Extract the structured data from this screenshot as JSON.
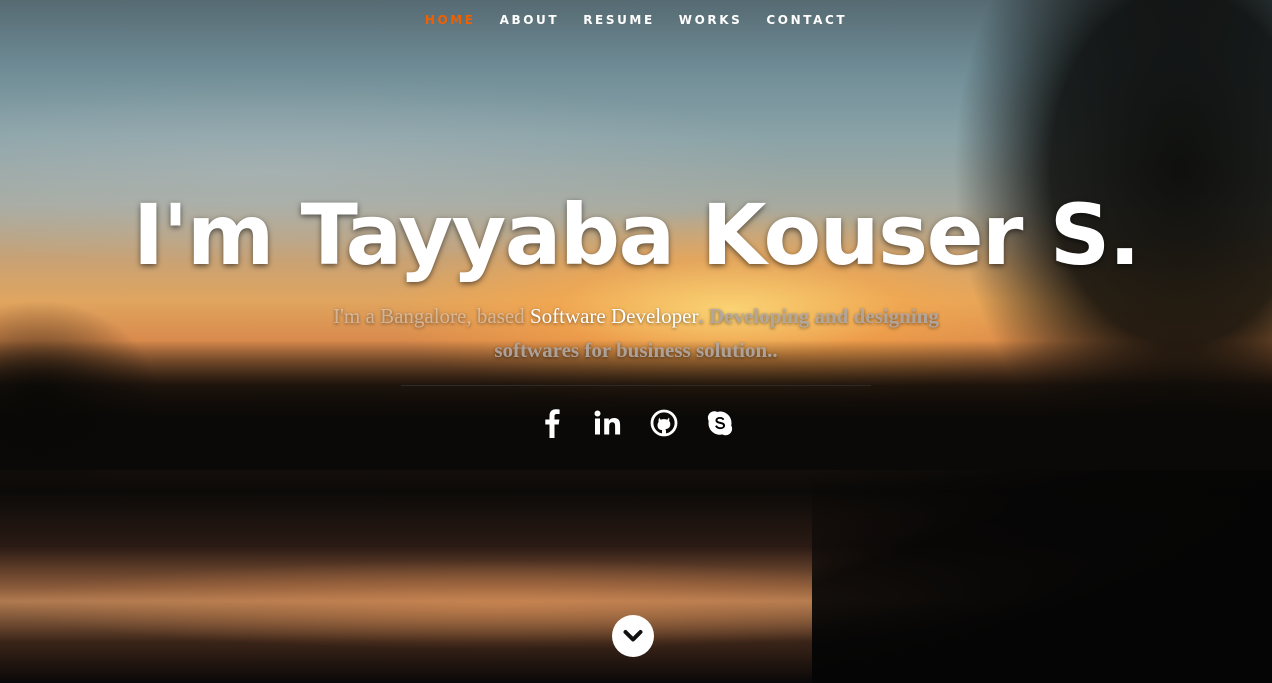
{
  "nav": {
    "items": [
      {
        "label": "HOME",
        "active": true
      },
      {
        "label": "ABOUT",
        "active": false
      },
      {
        "label": "RESUME",
        "active": false
      },
      {
        "label": "WORKS",
        "active": false
      },
      {
        "label": "CONTACT",
        "active": false
      }
    ],
    "active_color": "#f06000"
  },
  "banner": {
    "headline": "I'm Tayyaba Kouser S.",
    "tagline_prefix": "I'm a Bangalore, based ",
    "tagline_highlight": "Software Developer",
    "tagline_mid": ". ",
    "tagline_tail": "Developing and designing softwares for business solution.."
  },
  "social": {
    "icons": [
      "facebook-icon",
      "linkedin-icon",
      "github-icon",
      "skype-icon"
    ]
  },
  "scroll": {
    "icon": "chevron-down-icon"
  }
}
